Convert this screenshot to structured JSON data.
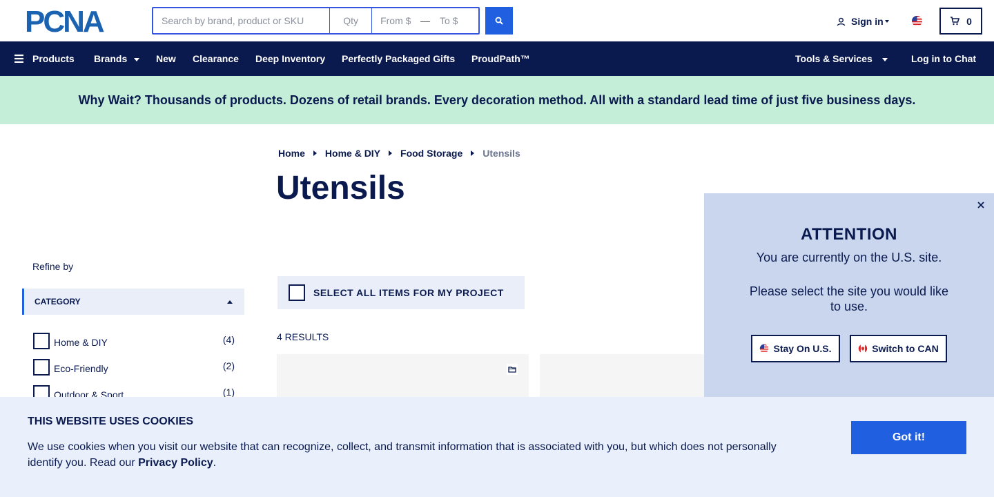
{
  "header": {
    "logo_text": "PCNA",
    "search_placeholder": "Search by brand, product or SKU",
    "qty_placeholder": "Qty",
    "price_from_placeholder": "From $",
    "price_to_placeholder": "To $",
    "price_separator": "—",
    "signin_label": "Sign in",
    "cart_count": "0"
  },
  "nav": {
    "products": "Products",
    "brands": "Brands",
    "new": "New",
    "clearance": "Clearance",
    "deep_inventory": "Deep Inventory",
    "packaged_gifts": "Perfectly Packaged Gifts",
    "proudpath": "ProudPath™",
    "tools": "Tools & Services",
    "chat": "Log in to Chat"
  },
  "promo": {
    "text": "Why Wait? Thousands of products. Dozens of retail brands. Every decoration method. All with a standard lead time of just five business days."
  },
  "breadcrumb": {
    "items": [
      "Home",
      "Home & DIY",
      "Food Storage"
    ],
    "current": "Utensils"
  },
  "page_title": "Utensils",
  "sidebar": {
    "refine_label": "Refine by",
    "category_header": "CATEGORY",
    "filters": [
      {
        "label": "Home & DIY",
        "count": "(4)"
      },
      {
        "label": "Eco-Friendly",
        "count": "(2)"
      },
      {
        "label": "Outdoor & Sport",
        "count": "(1)"
      }
    ]
  },
  "main": {
    "select_all_label": "SELECT ALL ITEMS FOR MY PROJECT",
    "results_label": "4 RESULTS"
  },
  "region_popup": {
    "title": "ATTENTION",
    "line1": "You are currently on the U.S. site.",
    "line2": "Please select the site you would like to use.",
    "stay_label": "Stay On U.S.",
    "switch_label": "Switch to CAN"
  },
  "cookie_banner": {
    "title": "THIS WEBSITE USES COOKIES",
    "text": "We use cookies when you visit our website that can recognize, collect, and transmit information that is associated with you, but which does not personally identify you. Read our",
    "link": "Privacy Policy",
    "text_end": ".",
    "button": "Got it!"
  },
  "colors": {
    "navy": "#0b1a4e",
    "accent_blue": "#1f5fe0",
    "promo_green": "#c5eed8",
    "popup_blue": "#c9d6ee",
    "cookie_bg": "#e9f0fb"
  }
}
